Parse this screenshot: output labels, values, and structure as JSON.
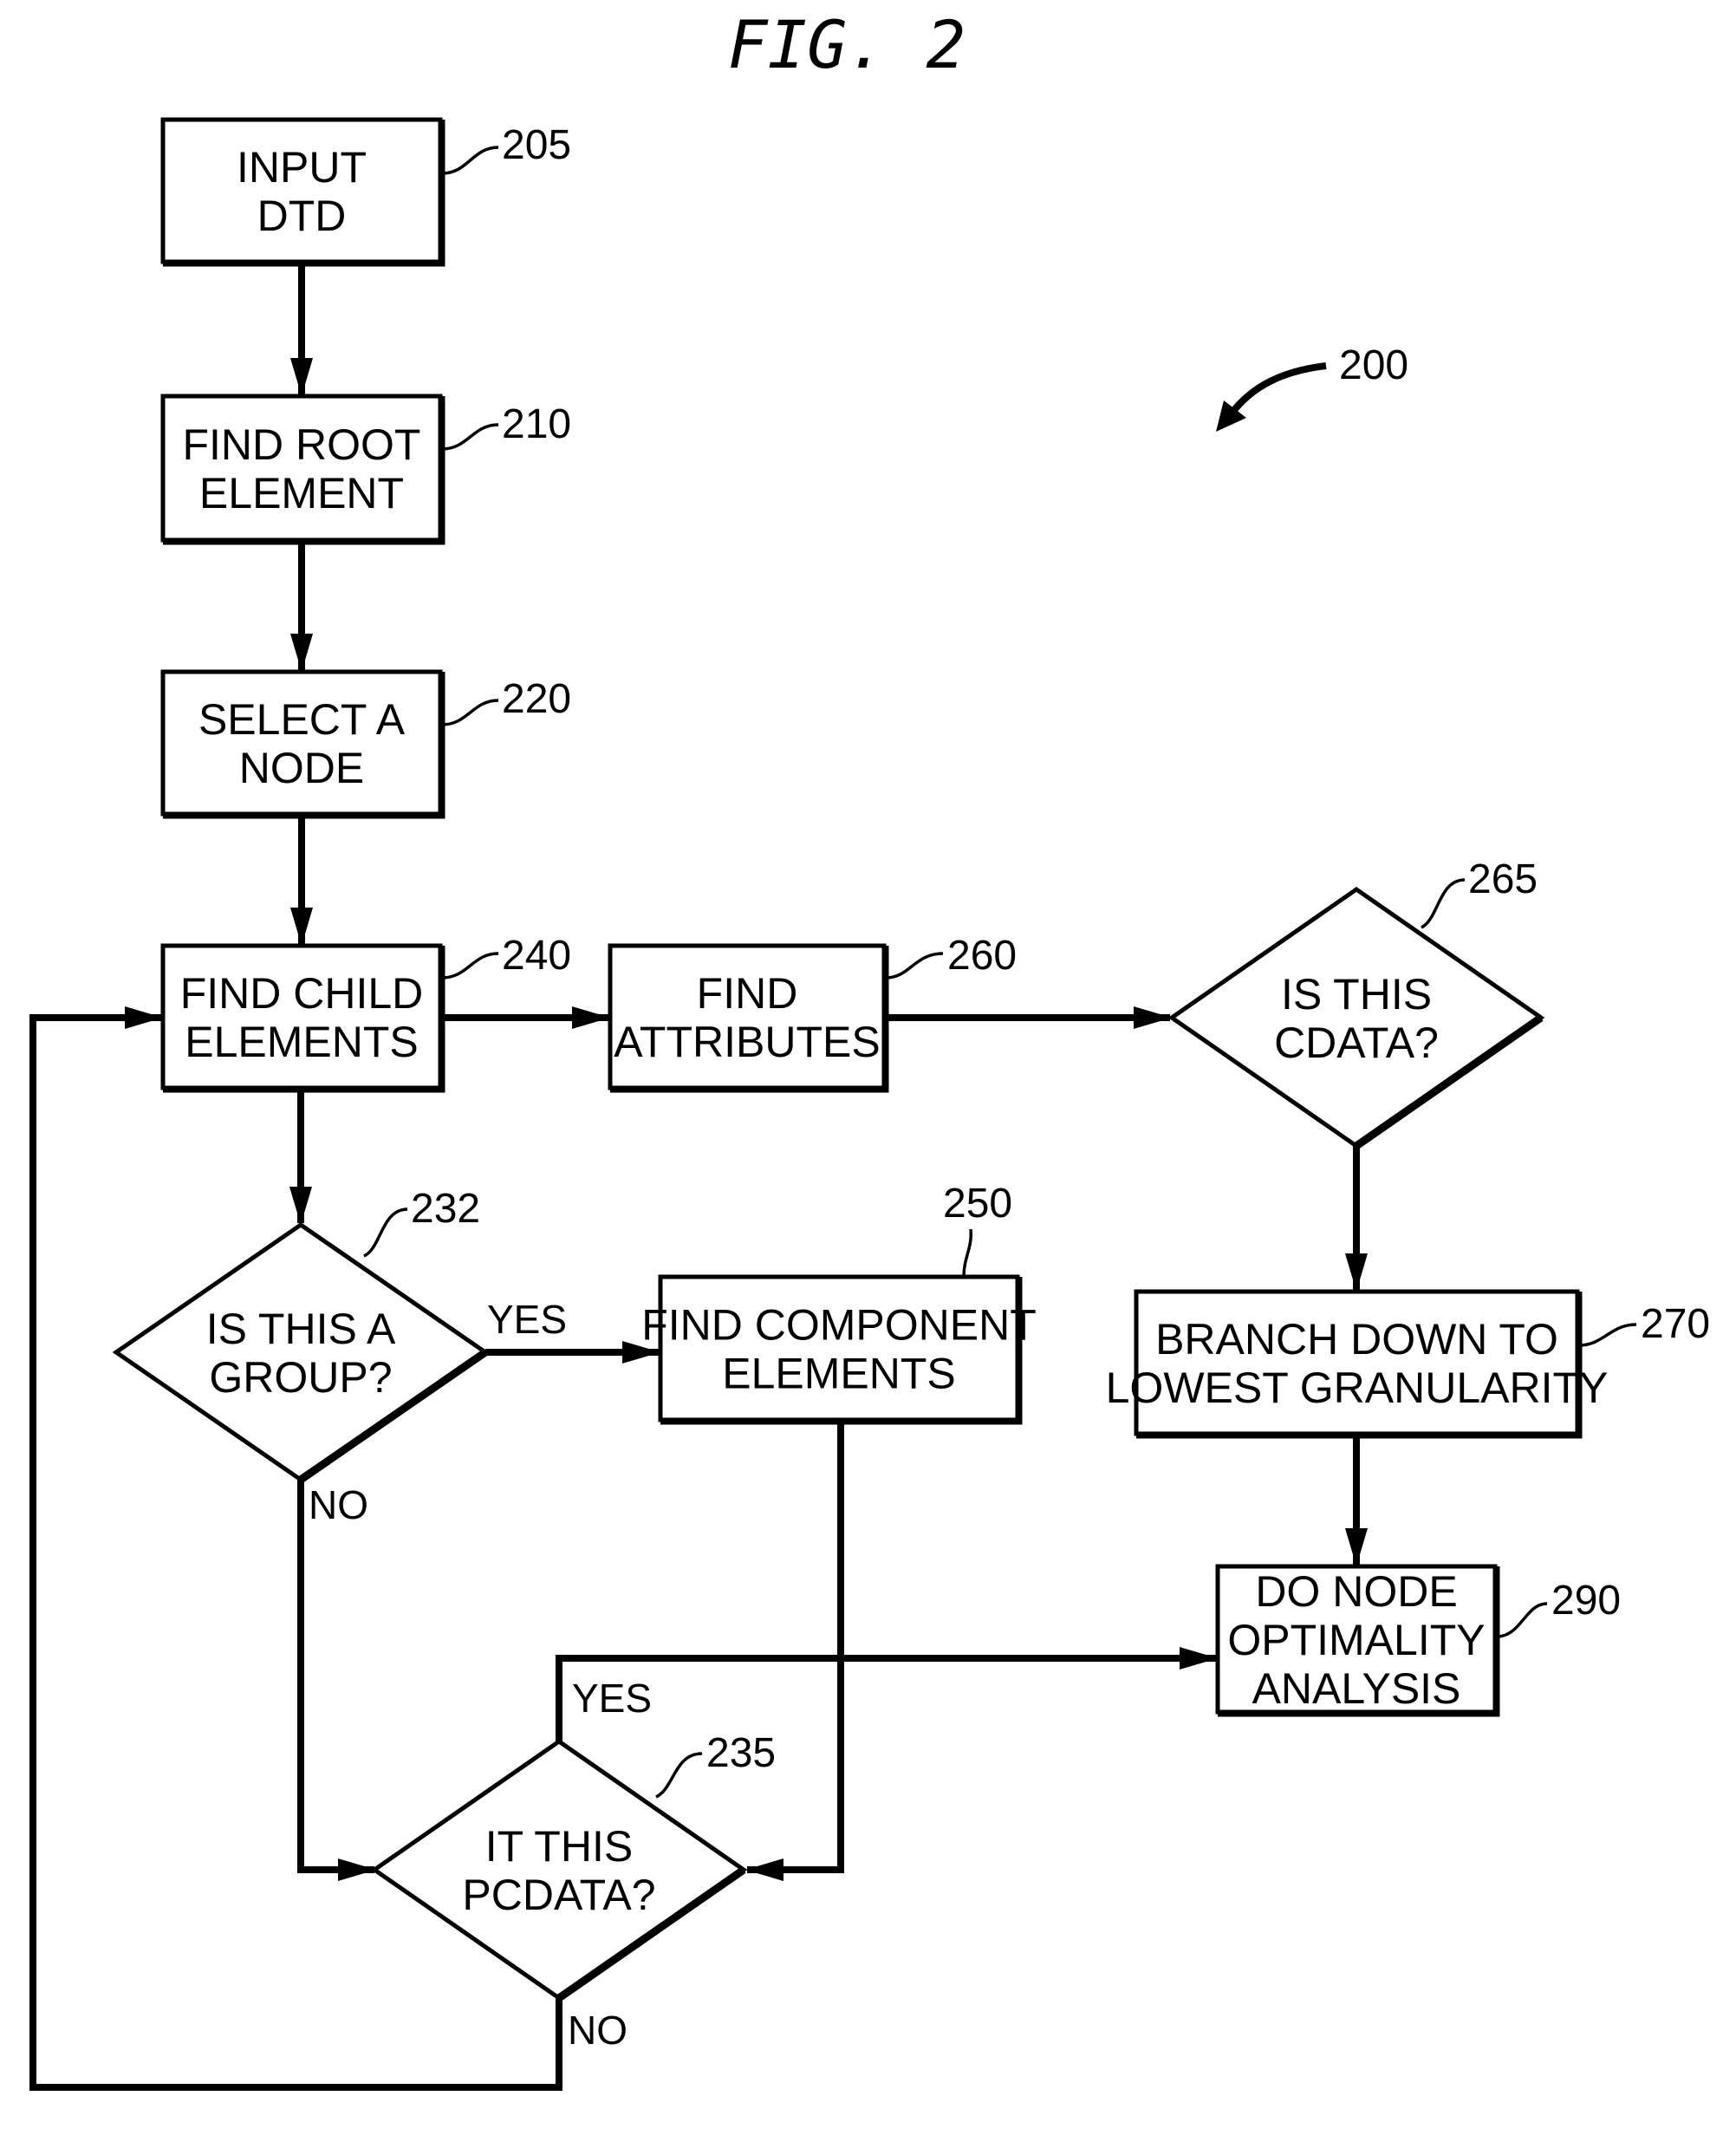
{
  "figure": {
    "title": "FIG. 2",
    "reference": "200"
  },
  "nodes": [
    {
      "id": "205",
      "type": "process",
      "lines": [
        "INPUT",
        "DTD"
      ]
    },
    {
      "id": "210",
      "type": "process",
      "lines": [
        "FIND ROOT",
        "ELEMENT"
      ]
    },
    {
      "id": "220",
      "type": "process",
      "lines": [
        "SELECT A",
        "NODE"
      ]
    },
    {
      "id": "240",
      "type": "process",
      "lines": [
        "FIND CHILD",
        "ELEMENTS"
      ]
    },
    {
      "id": "260",
      "type": "process",
      "lines": [
        "FIND",
        "ATTRIBUTES"
      ]
    },
    {
      "id": "265",
      "type": "decision",
      "lines": [
        "IS THIS",
        "CDATA?"
      ]
    },
    {
      "id": "232",
      "type": "decision",
      "lines": [
        "IS THIS A",
        "GROUP?"
      ]
    },
    {
      "id": "250",
      "type": "process",
      "lines": [
        "FIND COMPONENT",
        "ELEMENTS"
      ]
    },
    {
      "id": "270",
      "type": "process",
      "lines": [
        "BRANCH DOWN TO",
        "LOWEST GRANULARITY"
      ]
    },
    {
      "id": "290",
      "type": "process",
      "lines": [
        "DO NODE",
        "OPTIMALITY",
        "ANALYSIS"
      ]
    },
    {
      "id": "235",
      "type": "decision",
      "lines": [
        "IT THIS",
        "PCDATA?"
      ]
    }
  ],
  "edges": [
    {
      "from": "205",
      "to": "210",
      "label": ""
    },
    {
      "from": "210",
      "to": "220",
      "label": ""
    },
    {
      "from": "220",
      "to": "240",
      "label": ""
    },
    {
      "from": "240",
      "to": "260",
      "label": ""
    },
    {
      "from": "260",
      "to": "265",
      "label": ""
    },
    {
      "from": "265",
      "to": "270",
      "label": ""
    },
    {
      "from": "270",
      "to": "290",
      "label": ""
    },
    {
      "from": "240",
      "to": "232",
      "label": ""
    },
    {
      "from": "232",
      "to": "250",
      "label": "YES"
    },
    {
      "from": "232",
      "to": "235",
      "label": "NO"
    },
    {
      "from": "250",
      "to": "235",
      "label": ""
    },
    {
      "from": "235",
      "to": "290",
      "label": "YES"
    },
    {
      "from": "235",
      "to": "240",
      "label": "NO"
    }
  ],
  "flow_labels": {
    "yes_232": "YES",
    "no_232": "NO",
    "yes_235": "YES",
    "no_235": "NO"
  }
}
